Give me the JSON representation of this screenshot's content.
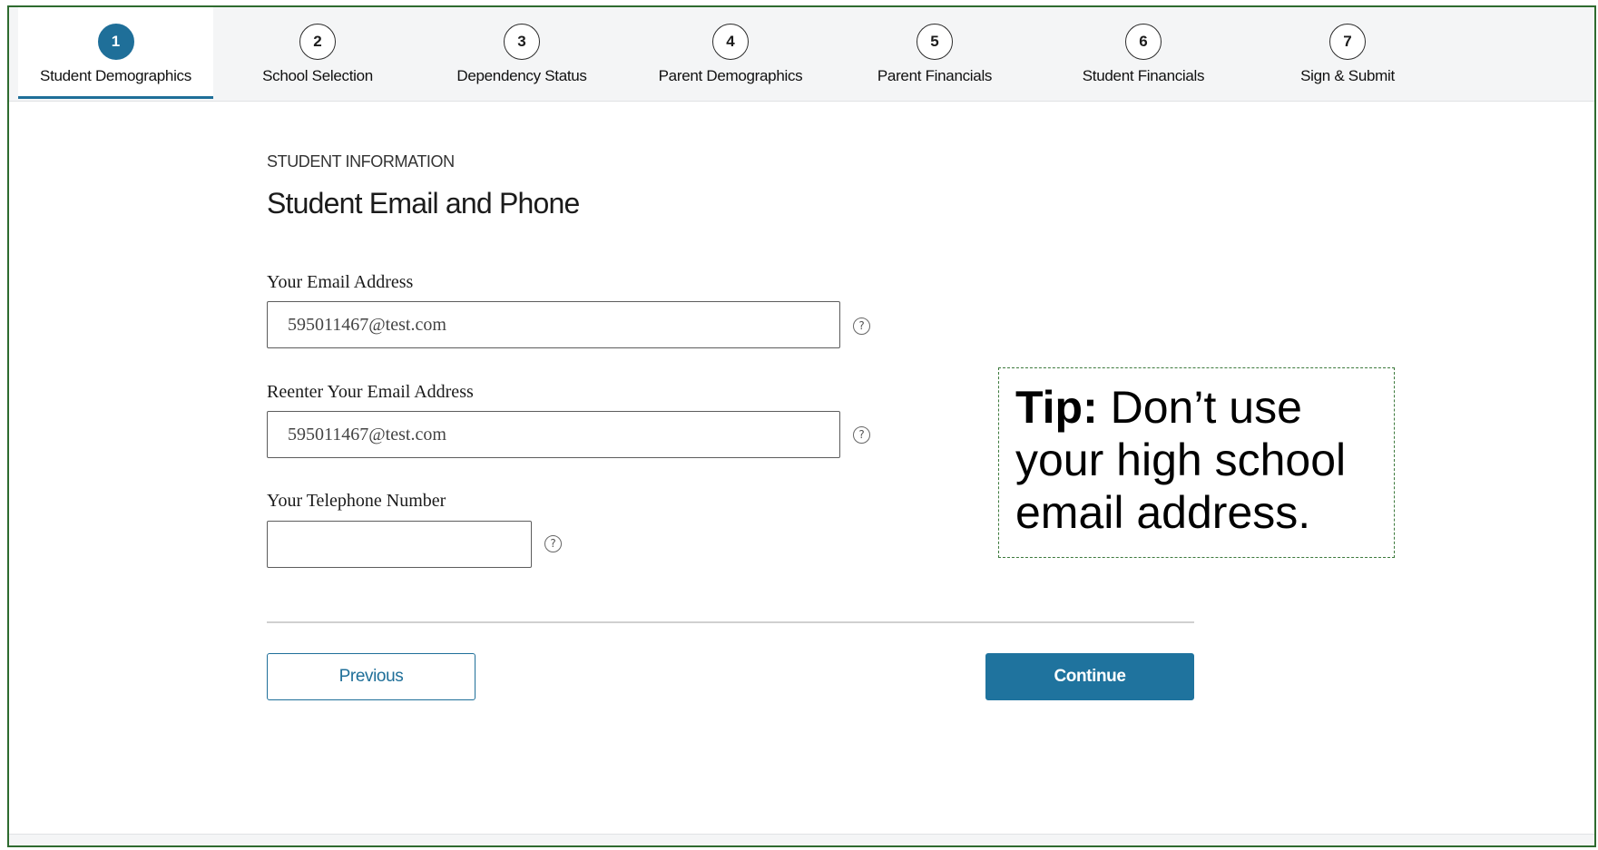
{
  "steps": [
    {
      "number": "1",
      "label": "Student Demographics",
      "active": true
    },
    {
      "number": "2",
      "label": "School Selection",
      "active": false
    },
    {
      "number": "3",
      "label": "Dependency Status",
      "active": false
    },
    {
      "number": "4",
      "label": "Parent Demographics",
      "active": false
    },
    {
      "number": "5",
      "label": "Parent Financials",
      "active": false
    },
    {
      "number": "6",
      "label": "Student Financials",
      "active": false
    },
    {
      "number": "7",
      "label": "Sign & Submit",
      "active": false
    }
  ],
  "section": {
    "eyebrow": "STUDENT INFORMATION",
    "title": "Student Email and Phone"
  },
  "fields": {
    "email": {
      "label": "Your Email Address",
      "value": "595011467@test.com"
    },
    "email_confirm": {
      "label": "Reenter Your Email Address",
      "value": "595011467@test.com"
    },
    "phone": {
      "label": "Your Telephone Number",
      "value": ""
    }
  },
  "help_icon": {
    "glyph": "?",
    "name": "question-circle-icon"
  },
  "buttons": {
    "previous": "Previous",
    "continue": "Continue"
  },
  "tip": {
    "heading": "Tip:",
    "text": "Don’t use your high school email address."
  },
  "colors": {
    "accent": "#1f6f99",
    "frame_border": "#2e6b2f",
    "tip_border": "#3d7a3d"
  }
}
